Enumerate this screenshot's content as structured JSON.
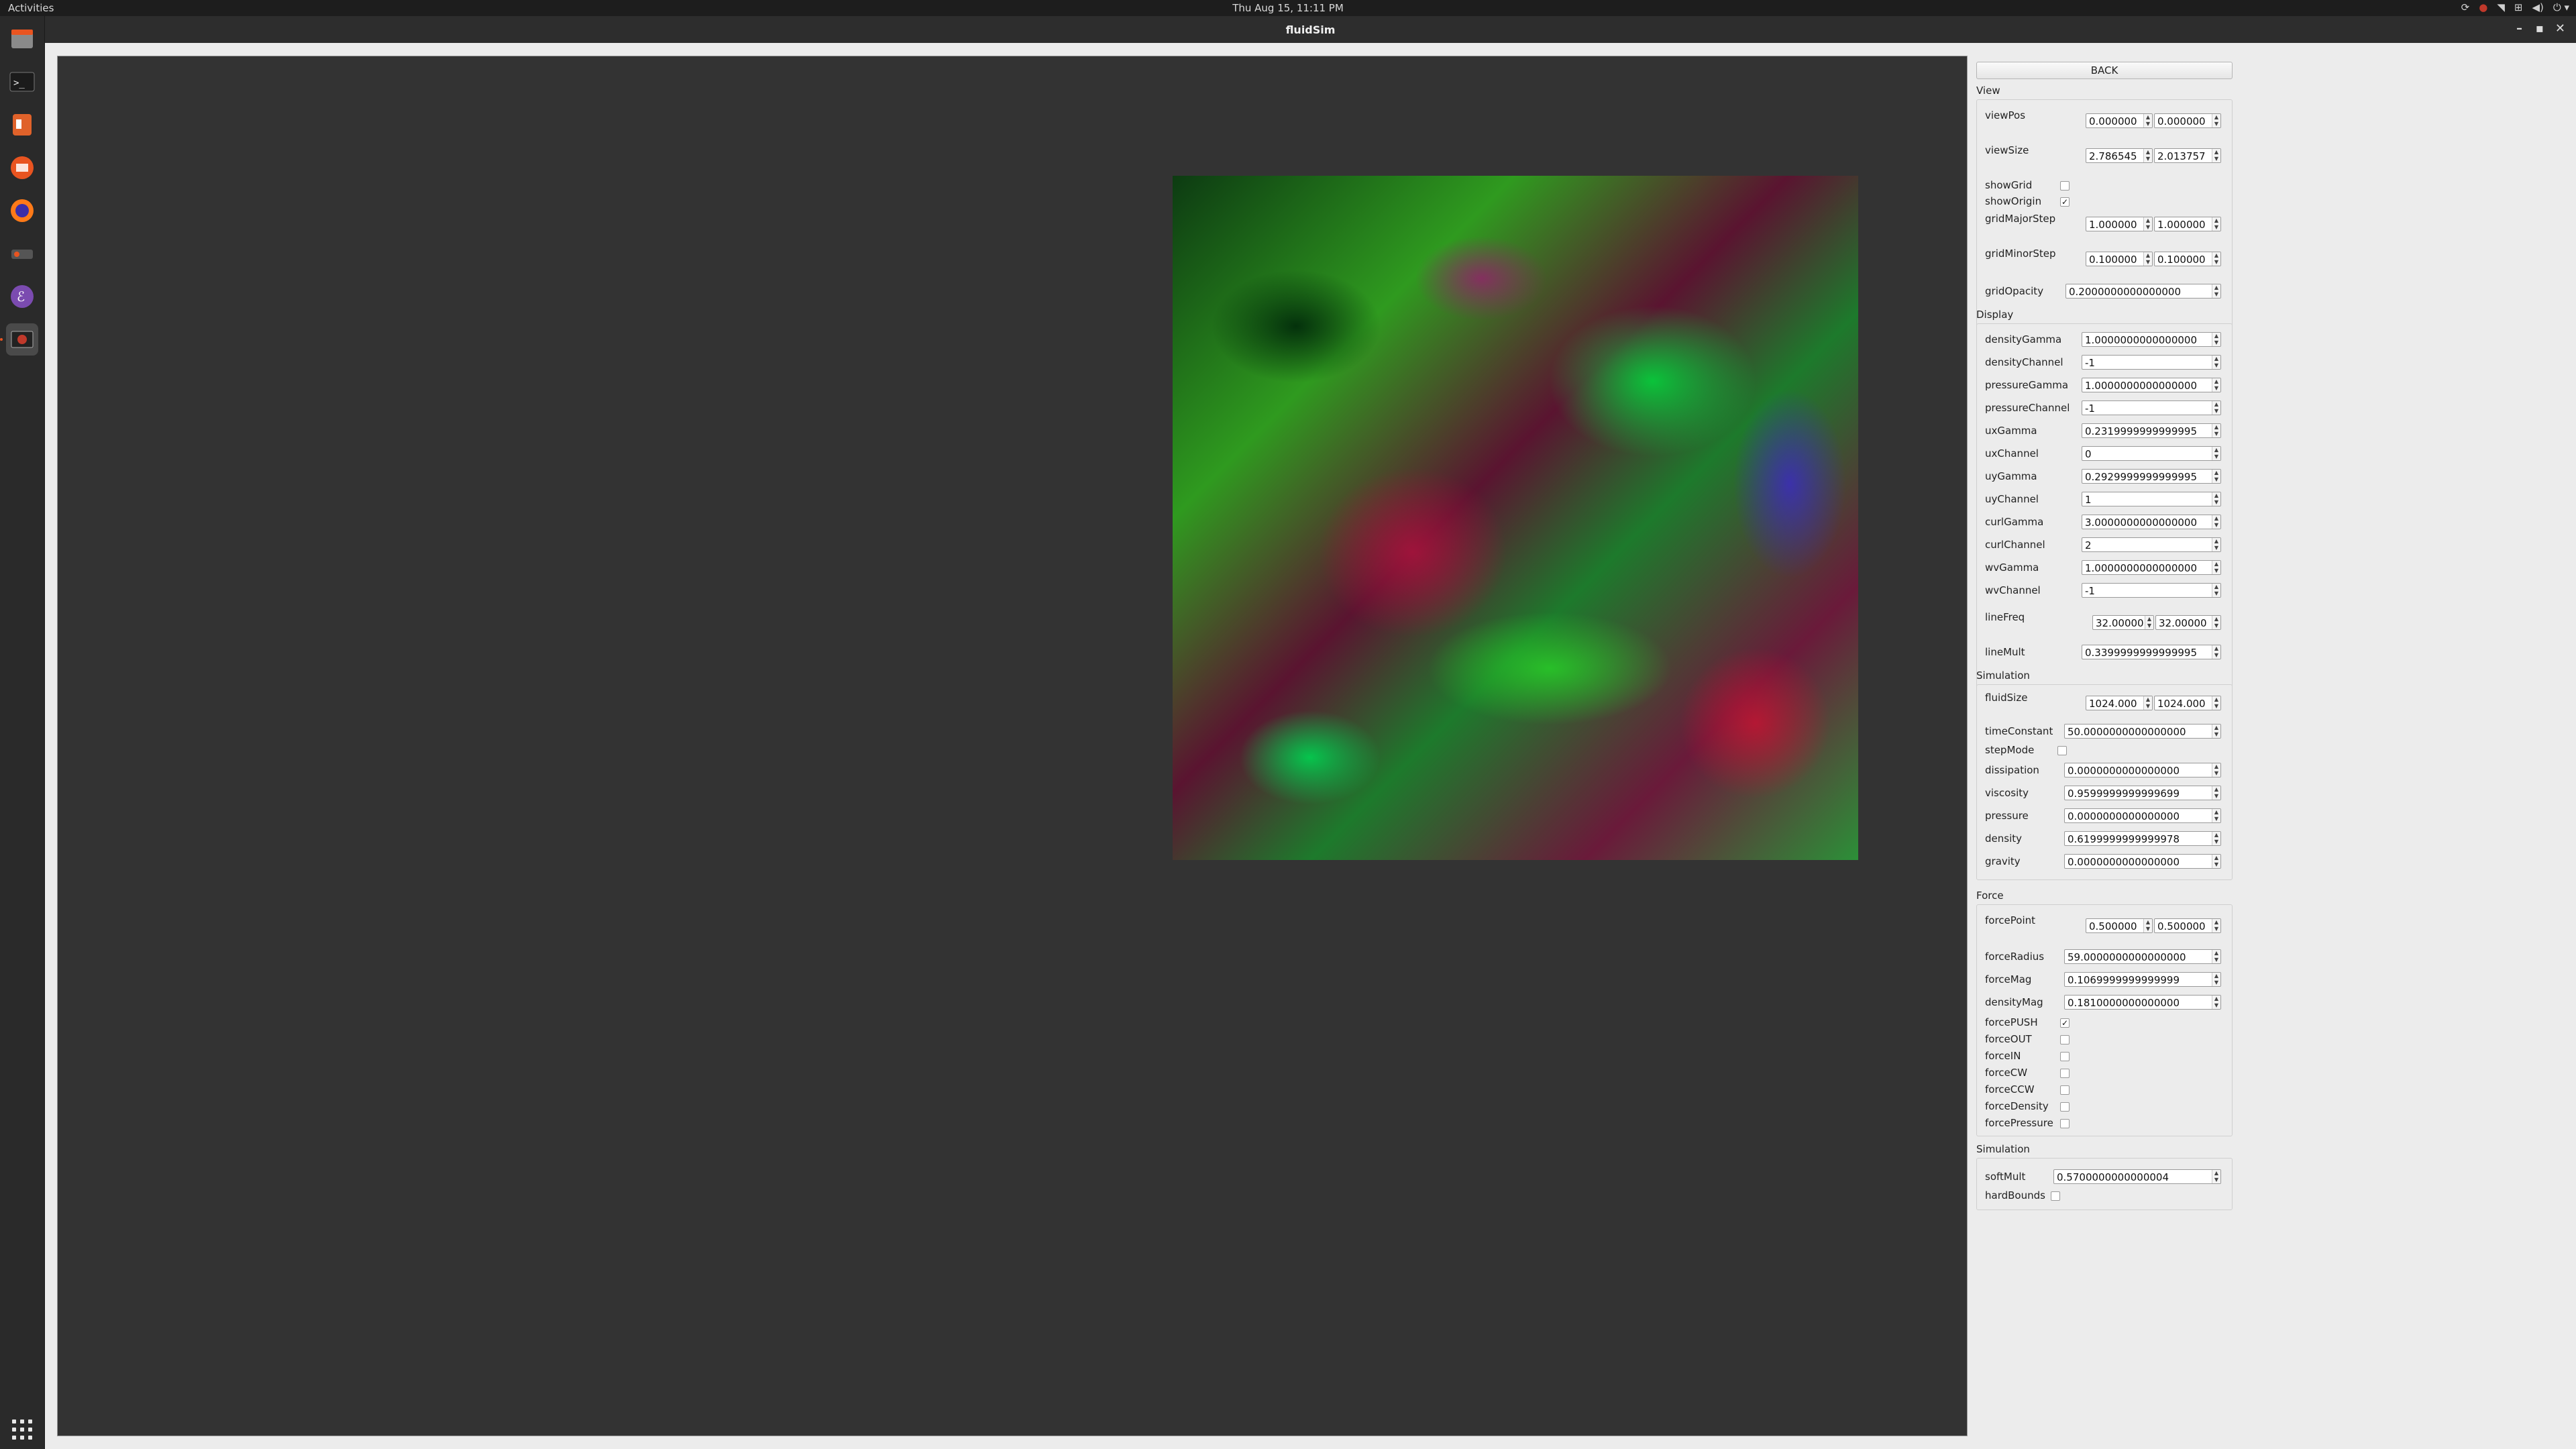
{
  "topbar": {
    "activities": "Activities",
    "clock": "Thu Aug 15, 11:11 PM"
  },
  "window": {
    "title": "fluidSim"
  },
  "panel": {
    "back": "BACK",
    "view": {
      "title": "View",
      "viewPos": {
        "label": "viewPos",
        "v1": "0.000000",
        "v2": "0.000000"
      },
      "viewSize": {
        "label": "viewSize",
        "v1": "2.786545",
        "v2": "2.013757"
      },
      "showGrid": {
        "label": "showGrid",
        "checked": false
      },
      "showOrigin": {
        "label": "showOrigin",
        "checked": true
      },
      "gridMajorStep": {
        "label": "gridMajorStep",
        "v1": "1.000000",
        "v2": "1.000000"
      },
      "gridMinorStep": {
        "label": "gridMinorStep",
        "v1": "0.100000",
        "v2": "0.100000"
      },
      "gridOpacity": {
        "label": "gridOpacity",
        "value": "0.2000000000000000"
      }
    },
    "display": {
      "title": "Display",
      "rows": [
        {
          "label": "densityGamma",
          "value": "1.0000000000000000"
        },
        {
          "label": "densityChannel",
          "value": "-1"
        },
        {
          "label": "pressureGamma",
          "value": "1.0000000000000000"
        },
        {
          "label": "pressureChannel",
          "value": "-1"
        },
        {
          "label": "uxGamma",
          "value": "0.2319999999999995"
        },
        {
          "label": "uxChannel",
          "value": "0"
        },
        {
          "label": "uyGamma",
          "value": "0.2929999999999995"
        },
        {
          "label": "uyChannel",
          "value": "1"
        },
        {
          "label": "curlGamma",
          "value": "3.0000000000000000"
        },
        {
          "label": "curlChannel",
          "value": "2"
        },
        {
          "label": "wvGamma",
          "value": "1.0000000000000000"
        },
        {
          "label": "wvChannel",
          "value": "-1"
        }
      ],
      "lineFreq": {
        "label": "lineFreq",
        "v1": "32.00000",
        "v2": "32.00000"
      },
      "lineMult": {
        "label": "lineMult",
        "value": "0.3399999999999995"
      }
    },
    "simulation": {
      "title": "Simulation",
      "fluidSize": {
        "label": "fluidSize",
        "v1": "1024.000",
        "v2": "1024.000"
      },
      "timeConstant": {
        "label": "timeConstant",
        "value": "50.0000000000000000"
      },
      "stepMode": {
        "label": "stepMode",
        "checked": false
      },
      "rows": [
        {
          "label": "dissipation",
          "value": "0.0000000000000000"
        },
        {
          "label": "viscosity",
          "value": "0.9599999999999699"
        },
        {
          "label": "pressure",
          "value": "0.0000000000000000"
        },
        {
          "label": "density",
          "value": "0.6199999999999978"
        },
        {
          "label": "gravity",
          "value": "0.0000000000000000"
        }
      ]
    },
    "force": {
      "title": "Force",
      "forcePoint": {
        "label": "forcePoint",
        "v1": "0.500000",
        "v2": "0.500000"
      },
      "rows": [
        {
          "label": "forceRadius",
          "value": "59.0000000000000000"
        },
        {
          "label": "forceMag",
          "value": "0.1069999999999999"
        },
        {
          "label": "densityMag",
          "value": "0.1810000000000000"
        }
      ],
      "checks": [
        {
          "label": "forcePUSH",
          "checked": true
        },
        {
          "label": "forceOUT",
          "checked": false
        },
        {
          "label": "forceIN",
          "checked": false
        },
        {
          "label": "forceCW",
          "checked": false
        },
        {
          "label": "forceCCW",
          "checked": false
        },
        {
          "label": "forceDensity",
          "checked": false
        },
        {
          "label": "forcePressure",
          "checked": false
        }
      ]
    },
    "simulation2": {
      "title": "Simulation",
      "softMult": {
        "label": "softMult",
        "value": "0.5700000000000004"
      },
      "hardBounds": {
        "label": "hardBounds",
        "checked": false
      }
    }
  }
}
